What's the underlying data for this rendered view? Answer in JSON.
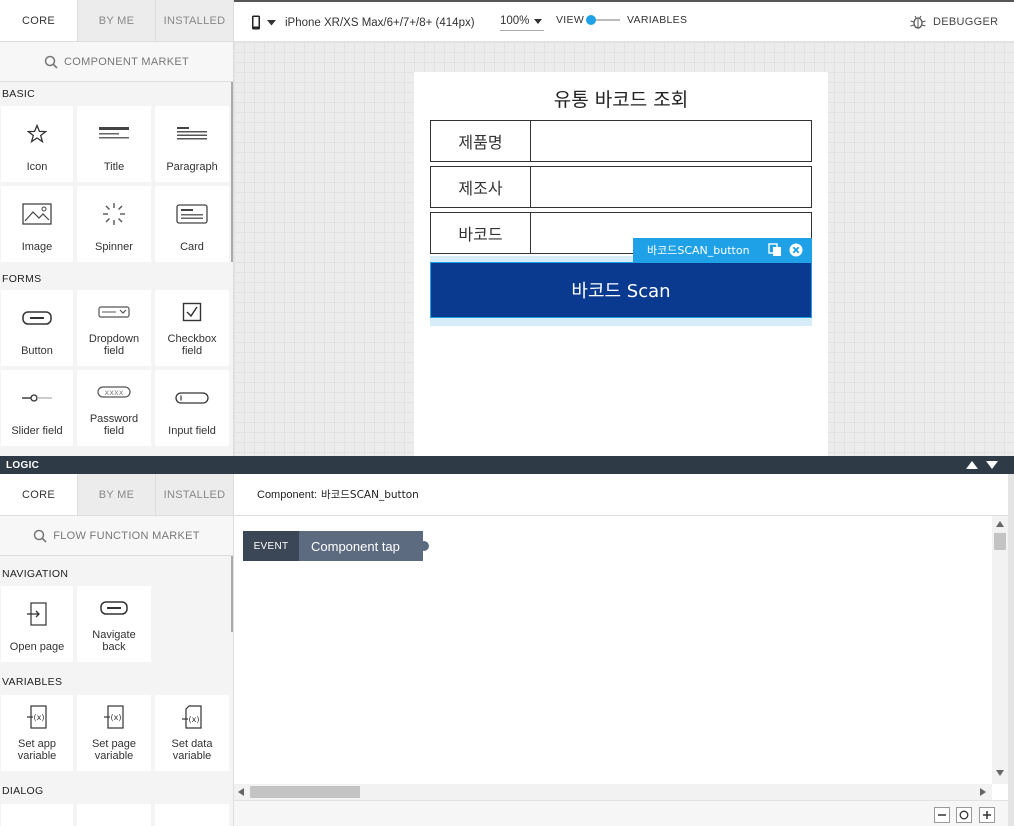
{
  "palette": {
    "tabs": [
      "CORE",
      "BY ME",
      "INSTALLED"
    ],
    "search_label": "COMPONENT MARKET",
    "sections": [
      {
        "title": "BASIC",
        "items": [
          {
            "label": "Icon",
            "icon": "star-icon"
          },
          {
            "label": "Title",
            "icon": "title-icon"
          },
          {
            "label": "Paragraph",
            "icon": "paragraph-icon"
          },
          {
            "label": "Image",
            "icon": "image-icon"
          },
          {
            "label": "Spinner",
            "icon": "spinner-icon"
          },
          {
            "label": "Card",
            "icon": "card-icon"
          }
        ]
      },
      {
        "title": "FORMS",
        "items": [
          {
            "label": "Button",
            "icon": "button-icon"
          },
          {
            "label": "Dropdown field",
            "icon": "dropdown-icon"
          },
          {
            "label": "Checkbox field",
            "icon": "checkbox-icon"
          },
          {
            "label": "Slider field",
            "icon": "slider-icon"
          },
          {
            "label": "Password field",
            "icon": "password-icon"
          },
          {
            "label": "Input field",
            "icon": "input-icon"
          }
        ]
      }
    ]
  },
  "topbar": {
    "device": "iPhone XR/XS Max/6+/7+/8+ (414px)",
    "zoom": "100%",
    "view_label": "VIEW",
    "variables_label": "VARIABLES",
    "debugger_label": "DEBUGGER"
  },
  "app_page": {
    "title": "유통 바코드 조회",
    "fields": [
      "제품명",
      "제조사",
      "바코드"
    ],
    "button_label": "바코드 Scan",
    "selected_tag": "바코드SCAN_button",
    "accent": "#0a3a8f",
    "selection_color": "#1ea1e6"
  },
  "logic": {
    "bar_label": "LOGIC",
    "tabs": [
      "CORE",
      "BY ME",
      "INSTALLED"
    ],
    "search_label": "FLOW FUNCTION MARKET",
    "sections": [
      {
        "title": "NAVIGATION",
        "items": [
          {
            "label": "Open page",
            "icon": "open-page-icon"
          },
          {
            "label": "Navigate back",
            "icon": "navigate-back-icon"
          }
        ]
      },
      {
        "title": "VARIABLES",
        "items": [
          {
            "label": "Set app variable",
            "icon": "set-app-variable-icon"
          },
          {
            "label": "Set page variable",
            "icon": "set-page-variable-icon"
          },
          {
            "label": "Set data variable",
            "icon": "set-data-variable-icon"
          }
        ]
      },
      {
        "title": "DIALOG",
        "items": []
      }
    ],
    "component_prefix": "Component:",
    "component_name": "바코드SCAN_button",
    "event_tag": "EVENT",
    "event_name": "Component tap"
  }
}
